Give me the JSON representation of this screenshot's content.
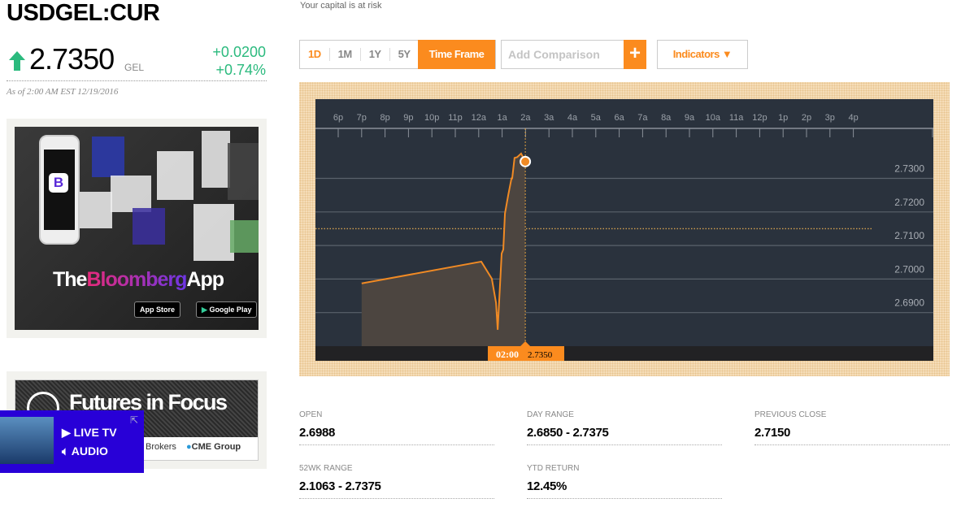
{
  "header": {
    "ticker": "USDGEL:CUR",
    "risk_note": "Your capital is at risk",
    "price": "2.7350",
    "currency": "GEL",
    "change": "+0.0200",
    "change_pct": "+0.74%",
    "as_of": "As of 2:00 AM EST 12/19/2016",
    "direction_icon": "arrow-up-icon"
  },
  "colors": {
    "accent": "#fb8b1e",
    "up": "#2bba7e",
    "chart_bg": "#2a323d",
    "live_bg": "#2800d7"
  },
  "ads": {
    "app": {
      "brand_pre": "The",
      "brand_mid": "Bloomberg",
      "brand_post": "App",
      "app_store": "App Store",
      "google_play": "Google Play",
      "logo_letter": "B"
    },
    "futures": {
      "title": "Futures in Focus",
      "sponsor1": "Brokers",
      "sponsor2": "CME Group"
    }
  },
  "live": {
    "tv": "LIVE TV",
    "audio": "AUDIO"
  },
  "toolbar": {
    "ranges": [
      "1D",
      "1M",
      "1Y",
      "5Y"
    ],
    "active_range": "1D",
    "time_frame": "Time Frame",
    "comparison_placeholder": "Add Comparison",
    "add_label": "+",
    "indicators": "Indicators ▼"
  },
  "chart_data": {
    "type": "area",
    "x_ticks": [
      "6p",
      "7p",
      "8p",
      "9p",
      "10p",
      "11p",
      "12a",
      "1a",
      "2a",
      "3a",
      "4a",
      "5a",
      "6a",
      "7a",
      "8a",
      "9a",
      "10a",
      "11a",
      "12p",
      "1p",
      "2p",
      "3p",
      "4p"
    ],
    "y_ticks": [
      "2.7300",
      "2.7200",
      "2.7100",
      "2.7000",
      "2.6900"
    ],
    "y_values": [
      2.73,
      2.72,
      2.71,
      2.7,
      2.69
    ],
    "x_unit": "hours since 6p",
    "points": [
      [
        1.0,
        2.6987
      ],
      [
        6.11,
        2.7052
      ],
      [
        6.56,
        2.7001
      ],
      [
        6.74,
        2.6929
      ],
      [
        6.81,
        2.6849
      ],
      [
        6.98,
        2.7076
      ],
      [
        7.05,
        2.7088
      ],
      [
        7.12,
        2.7195
      ],
      [
        7.26,
        2.725
      ],
      [
        7.4,
        2.73
      ],
      [
        7.43,
        2.73
      ],
      [
        7.53,
        2.7361
      ],
      [
        7.64,
        2.7363
      ],
      [
        7.81,
        2.7374
      ],
      [
        7.99,
        2.735
      ]
    ],
    "previous_close": 2.715,
    "cursor": {
      "time": "02:00",
      "value": "2.7350"
    }
  },
  "stats": [
    {
      "label": "Open",
      "value": "2.6988"
    },
    {
      "label": "Day Range",
      "value": "2.6850 - 2.7375"
    },
    {
      "label": "Previous Close",
      "value": "2.7150"
    },
    {
      "label": "52wk Range",
      "value": "2.1063 - 2.7375"
    },
    {
      "label": "YTD Return",
      "value": "12.45%"
    }
  ]
}
